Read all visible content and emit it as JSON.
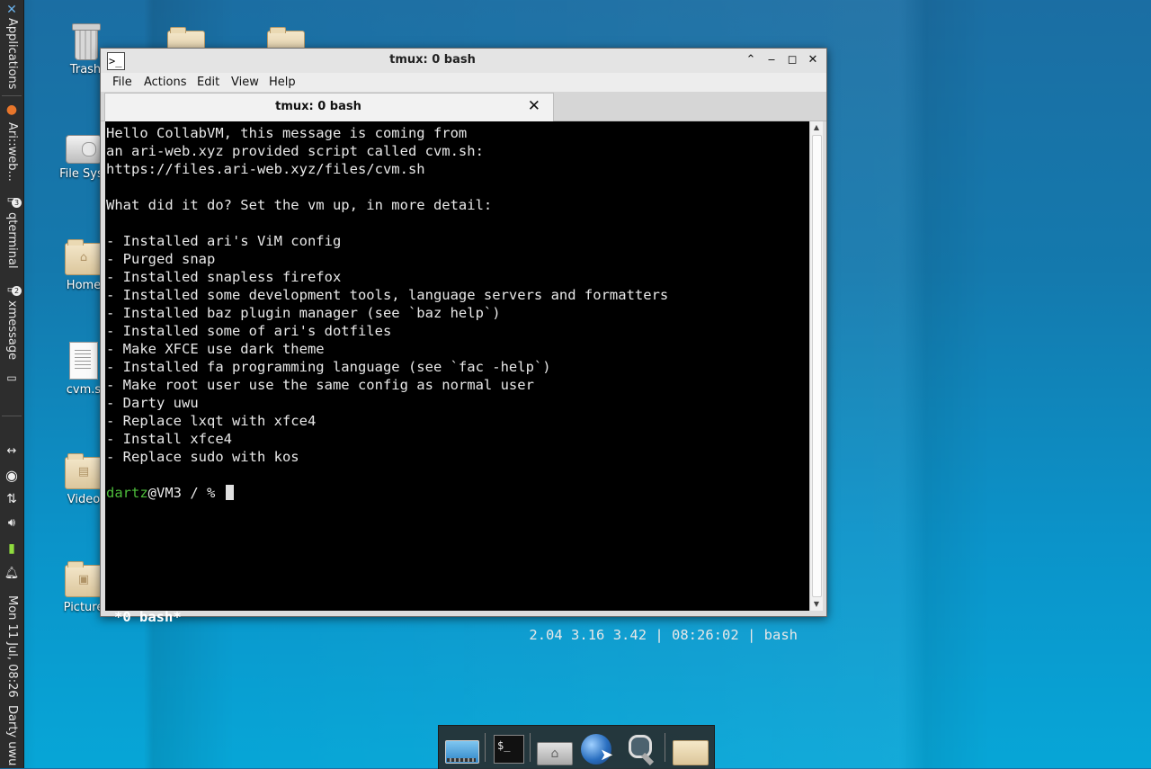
{
  "panel": {
    "applications_label": "Applications",
    "tasks": [
      {
        "label": "Ari::web...",
        "count": ""
      },
      {
        "label": "qterminal",
        "count": "3"
      },
      {
        "label": "xmessage",
        "count": "2"
      }
    ],
    "clock": "Mon 11 Jul, 08:26",
    "user": "Darty uwu"
  },
  "desktop": {
    "icons": [
      {
        "label": "Trash",
        "icon": "trash-icon"
      },
      {
        "label": "File Syst",
        "icon": "drive-icon"
      },
      {
        "label": "Home",
        "icon": "home-folder-icon"
      },
      {
        "label": "cvm.s",
        "icon": "text-file-icon"
      },
      {
        "label": "Video",
        "icon": "video-folder-icon"
      },
      {
        "label": "Picture",
        "icon": "pictures-folder-icon"
      }
    ]
  },
  "window": {
    "title": "tmux: 0 bash",
    "menu": [
      "File",
      "Actions",
      "Edit",
      "View",
      "Help"
    ],
    "tab_label": "tmux: 0 bash",
    "terminal": {
      "lines": [
        "Hello CollabVM, this message is coming from",
        "an ari-web.xyz provided script called cvm.sh:",
        "https://files.ari-web.xyz/files/cvm.sh",
        "",
        "What did it do? Set the vm up, in more detail:",
        "",
        "- Installed ari's ViM config",
        "- Purged snap",
        "- Installed snapless firefox",
        "- Installed some development tools, language servers and formatters",
        "- Installed baz plugin manager (see `baz help`)",
        "- Installed some of ari's dotfiles",
        "- Make XFCE use dark theme",
        "- Installed fa programming language (see `fac -help`)",
        "- Make root user use the same config as normal user",
        "- Darty uwu",
        "- Replace lxqt with xfce4",
        "- Install xfce4",
        "- Replace sudo with kos",
        ""
      ],
      "prompt_user": "dartz",
      "prompt_rest": "@VM3 / % "
    },
    "status_left": "*0 bash*",
    "status_right": "2.04 3.16 3.42 | 08:26:02 | bash"
  },
  "dock": {
    "items": [
      "desktop-icon",
      "terminal-icon",
      "home-folder-icon",
      "web-browser-icon",
      "search-icon",
      "folder-icon"
    ]
  },
  "colors": {
    "prompt_user": "#4cbb3a",
    "terminal_bg": "#000000",
    "panel_bg": "#2d2d2d"
  }
}
